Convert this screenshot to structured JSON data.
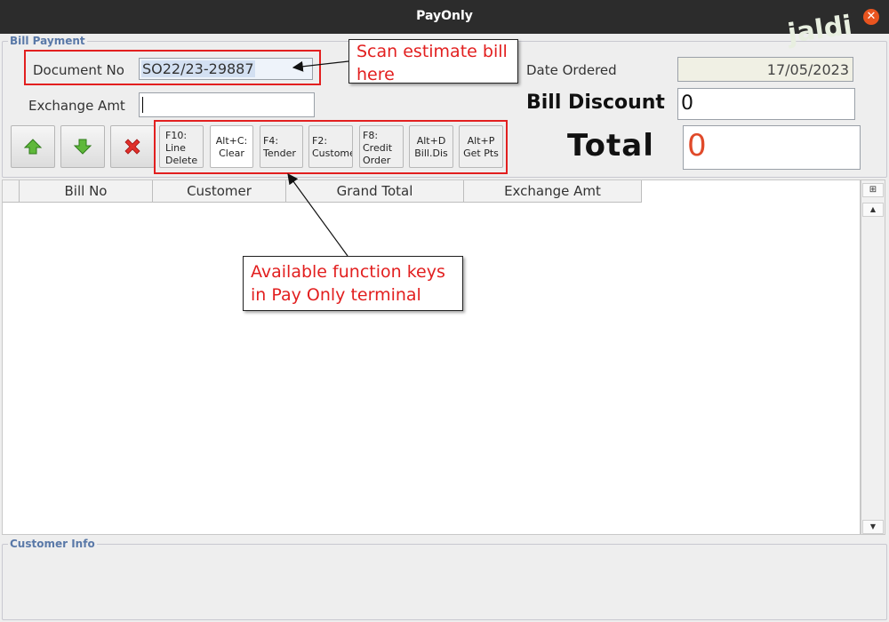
{
  "window": {
    "title": "PayOnly",
    "close_icon": "close-icon"
  },
  "watermark": {
    "text": "jaldi"
  },
  "bill_payment": {
    "legend": "Bill Payment",
    "document_no_label": "Document No",
    "document_no_value": "SO22/23-29887",
    "exchange_amt_label": "Exchange Amt",
    "exchange_amt_value": "",
    "date_ordered_label": "Date Ordered",
    "date_ordered_value": "17/05/2023",
    "bill_discount_label": "Bill Discount",
    "bill_discount_value": "0",
    "total_label": "Total",
    "total_value": "0"
  },
  "toolbar": {
    "icons": [
      "arrow-up-icon",
      "arrow-down-icon",
      "delete-x-icon"
    ],
    "function_keys": [
      {
        "lines": [
          "F10:",
          "Line",
          "Delete"
        ]
      },
      {
        "lines": [
          "Alt+C:",
          "Clear"
        ]
      },
      {
        "lines": [
          "F4:",
          "Tender"
        ]
      },
      {
        "lines": [
          "F2:",
          "Customer"
        ]
      },
      {
        "lines": [
          "F8:",
          "Credit",
          "Order"
        ]
      },
      {
        "lines": [
          "Alt+D",
          "Bill.Dis"
        ]
      },
      {
        "lines": [
          "Alt+P",
          "Get Pts"
        ]
      }
    ]
  },
  "table": {
    "columns": [
      "Bill No",
      "Customer",
      "Grand Total",
      "Exchange Amt"
    ],
    "rows": []
  },
  "customer_info": {
    "legend": "Customer Info"
  },
  "annotations": {
    "scan_callout": [
      "Scan estimate bill",
      "here"
    ],
    "fkeys_callout": [
      "Available function keys",
      "in Pay Only terminal"
    ]
  },
  "colors": {
    "annotation_red": "#e21f1f",
    "total_red": "#e04a2a",
    "legend_blue": "#5a79a8"
  }
}
